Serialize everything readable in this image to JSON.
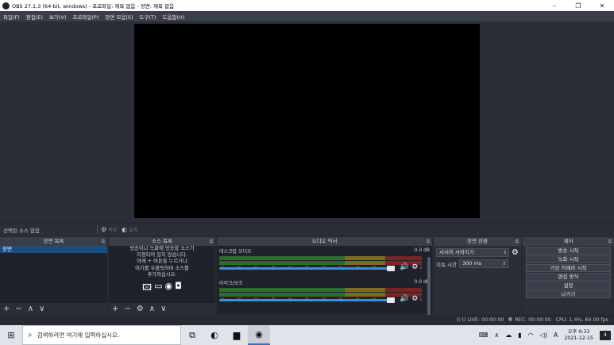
{
  "window": {
    "title": "OBS 27.1.3 (64-bit, windows) - 프로파일: 제목 없음 - 장면: 제목 없음",
    "controls": [
      "–",
      "❐",
      "✕"
    ]
  },
  "menu": [
    "파일(F)",
    "편집(E)",
    "보기(V)",
    "프로파일(P)",
    "장면 모음(S)",
    "도구(T)",
    "도움말(H)"
  ],
  "source_toolbar": {
    "no_source": "선택된 소스 없음",
    "properties_label": "속성",
    "filters_label": "효과"
  },
  "scenes": {
    "title": "장면 목록",
    "items": [
      "장면"
    ],
    "footer": [
      "+",
      "−",
      "∧",
      "∨"
    ]
  },
  "sources": {
    "title": "소스 목록",
    "empty_lines": [
      "방송이나 녹화에 방송할 소스가",
      "지정되어 있지 않습니다.",
      "아래 + 버튼을 누르거나",
      "여기를 우클릭하여 소스를",
      "추가하십시오."
    ],
    "footer": [
      "+",
      "−",
      "⚙",
      "∧",
      "∨"
    ]
  },
  "mixer": {
    "title": "오디오 믹서",
    "ticks": [
      "-60",
      "-55",
      "-50",
      "-45",
      "-40",
      "-35",
      "-30",
      "-25",
      "-20",
      "-15",
      "-10",
      "-5",
      "0"
    ],
    "channels": [
      {
        "name": "데스크탑 오디오",
        "level": "0.0 dB",
        "volume": 1.0
      },
      {
        "name": "마이크/보조",
        "level": "0.0 dB",
        "volume": 1.0
      }
    ]
  },
  "transitions": {
    "title": "장면 전환",
    "selected": "서서히 사라지기",
    "duration_label": "지속 시간",
    "duration_value": "300 ms"
  },
  "controls": {
    "title": "제어",
    "buttons": [
      "방송 시작",
      "녹화 시작",
      "가상 카메라 시작",
      "편집 방식",
      "설정",
      "나가기"
    ]
  },
  "status": {
    "live": "LIVE: 00:00:00",
    "rec": "REC: 00:00:00",
    "cpu": "CPU: 1.4%, 60.00 fps"
  },
  "taskbar": {
    "search_placeholder": "검색하려면 여기에 입력하십시오.",
    "time": "오후 9:33",
    "date": "2021-12-15",
    "notification_count": "4"
  },
  "colors": {
    "selection": "#1e4d7c",
    "fader": "#3b8ede",
    "meter_green": "#2e6b2e",
    "meter_yellow": "#7a6d20",
    "meter_red": "#7a2424"
  }
}
